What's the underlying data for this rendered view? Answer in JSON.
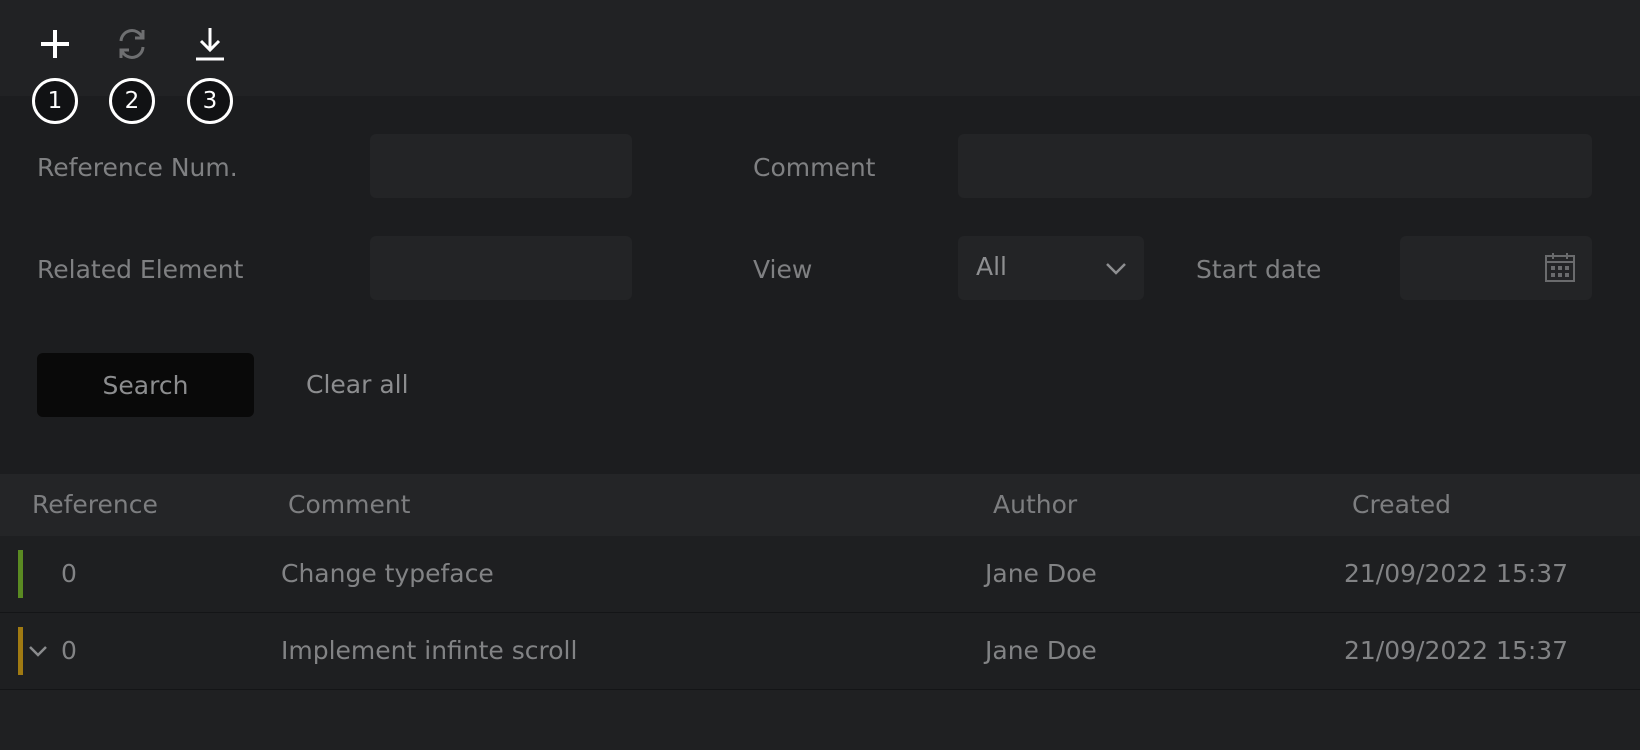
{
  "toolbar": {
    "tools": [
      {
        "icon": "plus-icon",
        "callout": "1"
      },
      {
        "icon": "refresh-icon",
        "callout": "2"
      },
      {
        "icon": "download-icon",
        "callout": "3"
      }
    ]
  },
  "filters": {
    "reference_label": "Reference Num.",
    "reference_value": "",
    "comment_label": "Comment",
    "comment_value": "",
    "related_label": "Related Element",
    "related_value": "",
    "view_label": "View",
    "view_value": "All",
    "start_date_label": "Start date",
    "start_date_value": "",
    "search_label": "Search",
    "clear_label": "Clear all"
  },
  "table": {
    "columns": [
      "Reference",
      "Comment",
      "Author",
      "Created"
    ],
    "rows": [
      {
        "reference": "0",
        "comment": "Change typeface",
        "author": "Jane Doe",
        "created": "21/09/2022 15:37",
        "status_color": "#5a8a22",
        "expandable": false
      },
      {
        "reference": "0",
        "comment": "Implement infinte scroll",
        "author": "Jane Doe",
        "created": "21/09/2022 15:37",
        "status_color": "#a07a12",
        "expandable": true
      }
    ]
  },
  "colors": {
    "background": "#1c1d1f",
    "toolbar": "#212224",
    "field": "#232426",
    "search_button": "#090909"
  }
}
